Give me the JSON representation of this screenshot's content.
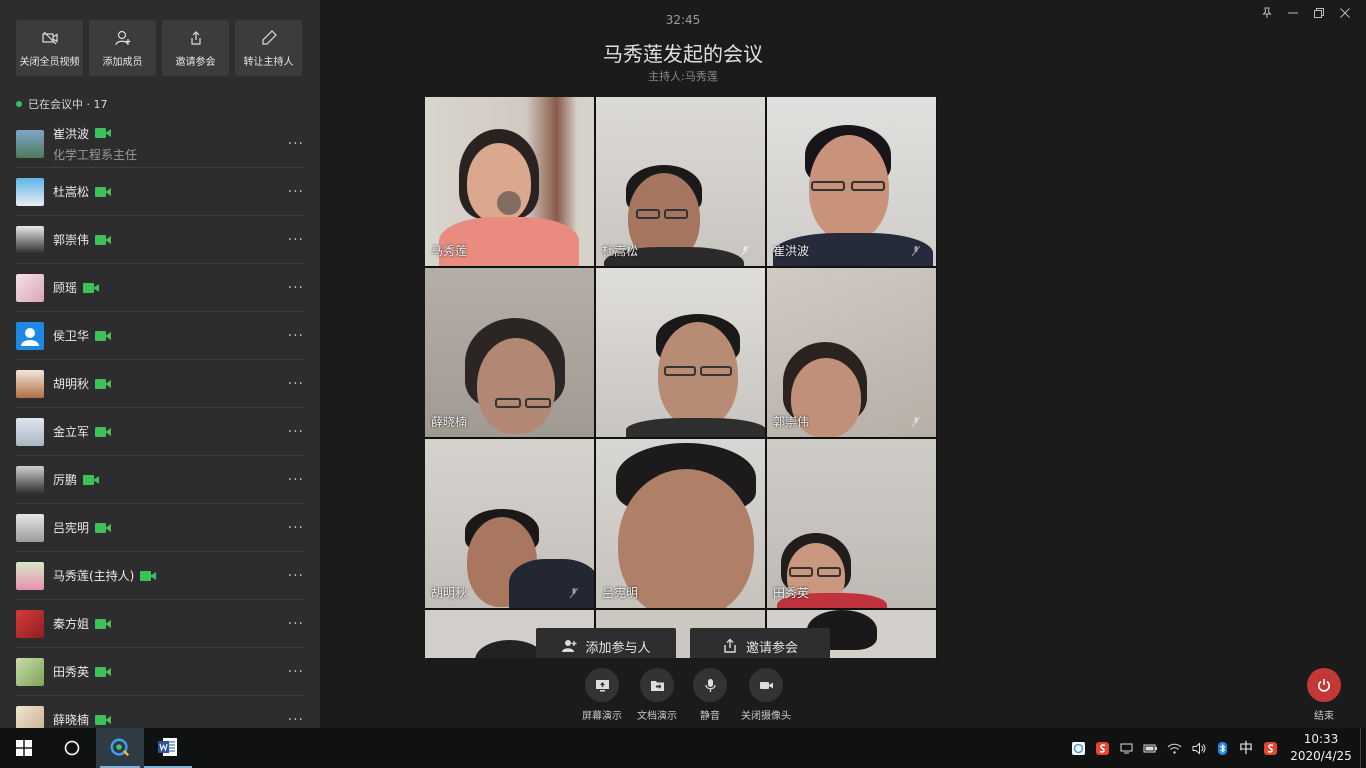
{
  "left_panel": {
    "actions": [
      {
        "label": "关闭全员视频",
        "icon": "video-off-icon"
      },
      {
        "label": "添加成员",
        "icon": "add-user-icon"
      },
      {
        "label": "邀请参会",
        "icon": "share-icon"
      },
      {
        "label": "转让主持人",
        "icon": "pen-icon"
      }
    ],
    "status": "已在会议中 · 17",
    "members": [
      {
        "name": "崔洪波",
        "subtitle": "化学工程系主任",
        "video_on": true
      },
      {
        "name": "杜嵩松",
        "video_on": true
      },
      {
        "name": "郭崇伟",
        "video_on": true
      },
      {
        "name": "顾瑶",
        "video_on": true
      },
      {
        "name": "侯卫华",
        "video_on": true
      },
      {
        "name": "胡明秋",
        "video_on": true
      },
      {
        "name": "金立军",
        "video_on": true
      },
      {
        "name": "厉鹏",
        "video_on": true
      },
      {
        "name": "吕宪明",
        "video_on": true
      },
      {
        "name": "马秀莲(主持人)",
        "video_on": true
      },
      {
        "name": "秦方姐",
        "video_on": true
      },
      {
        "name": "田秀英",
        "video_on": true
      },
      {
        "name": "薛晓楠",
        "video_on": true
      }
    ],
    "more_label": "···"
  },
  "main": {
    "timer": "32:45",
    "title": "马秀莲发起的会议",
    "host": "主持人:马秀莲",
    "tiles": [
      {
        "name": "马秀莲"
      },
      {
        "name": "杜嵩松"
      },
      {
        "name": "崔洪波"
      },
      {
        "name": "薛晓楠"
      },
      {
        "name": ""
      },
      {
        "name": "郭崇伟"
      },
      {
        "name": "胡明秋"
      },
      {
        "name": "吕宪明"
      },
      {
        "name": "田秀英"
      }
    ],
    "add_participant": "添加参与人",
    "invite": "邀请参会",
    "controls": [
      {
        "label": "屏幕演示",
        "icon": "screen-share-icon"
      },
      {
        "label": "文档演示",
        "icon": "folder-icon"
      },
      {
        "label": "静音",
        "icon": "microphone-icon"
      },
      {
        "label": "关闭摄像头",
        "icon": "camera-icon"
      }
    ],
    "end": "结束"
  },
  "taskbar": {
    "ime": "中",
    "time": "10:33",
    "date": "2020/4/25"
  },
  "colors": {
    "accent_green": "#3cc25a",
    "end_red": "#c43737",
    "panel": "#2d2d2d"
  }
}
